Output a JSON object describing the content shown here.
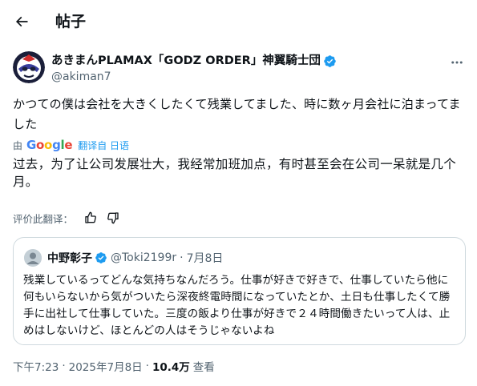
{
  "header": {
    "title": "帖子",
    "back_icon": "arrow-left-icon"
  },
  "post": {
    "author_name": "あきまんPLAMAX「GODZ ORDER」神翼騎士団",
    "author_handle": "@akiman7",
    "verified_color": "#1d9bf0",
    "original_text": "かつての僕は会社を大きくしたくて残業してました、時に数ヶ月会社に泊まってました",
    "translated_by_prefix": "由",
    "translated_by_provider": "Google",
    "translated_from": "翻译自 日语",
    "translated_text": "过去，为了让公司发展壮大，我经常加班加点，有时甚至会在公司一呆就是几个月。",
    "rate_label": "评价此翻译："
  },
  "quote": {
    "author_name": "中野彰子",
    "author_handle": "@Toki2199r",
    "separator": "·",
    "date": "7月8日",
    "text": "残業しているってどんな気持ちなんだろう。仕事が好きで好きで、仕事していたら他に何もいらないから気がついたら深夜終電時間になっていたとか、土日も仕事したくて勝手に出社して仕事していた。三度の飯より仕事が好きで２４時間働きたいって人は、止めはしないけど、ほとんどの人はそうじゃないよね"
  },
  "meta": {
    "time": "下午7:23",
    "sep1": "·",
    "date": "2025年7月8日",
    "sep2": "·",
    "views_count": "10.4万",
    "views_label": "查看"
  },
  "colors": {
    "text": "#0f1419",
    "secondary": "#536471",
    "accent": "#1d9bf0",
    "border": "#cfd9de"
  }
}
